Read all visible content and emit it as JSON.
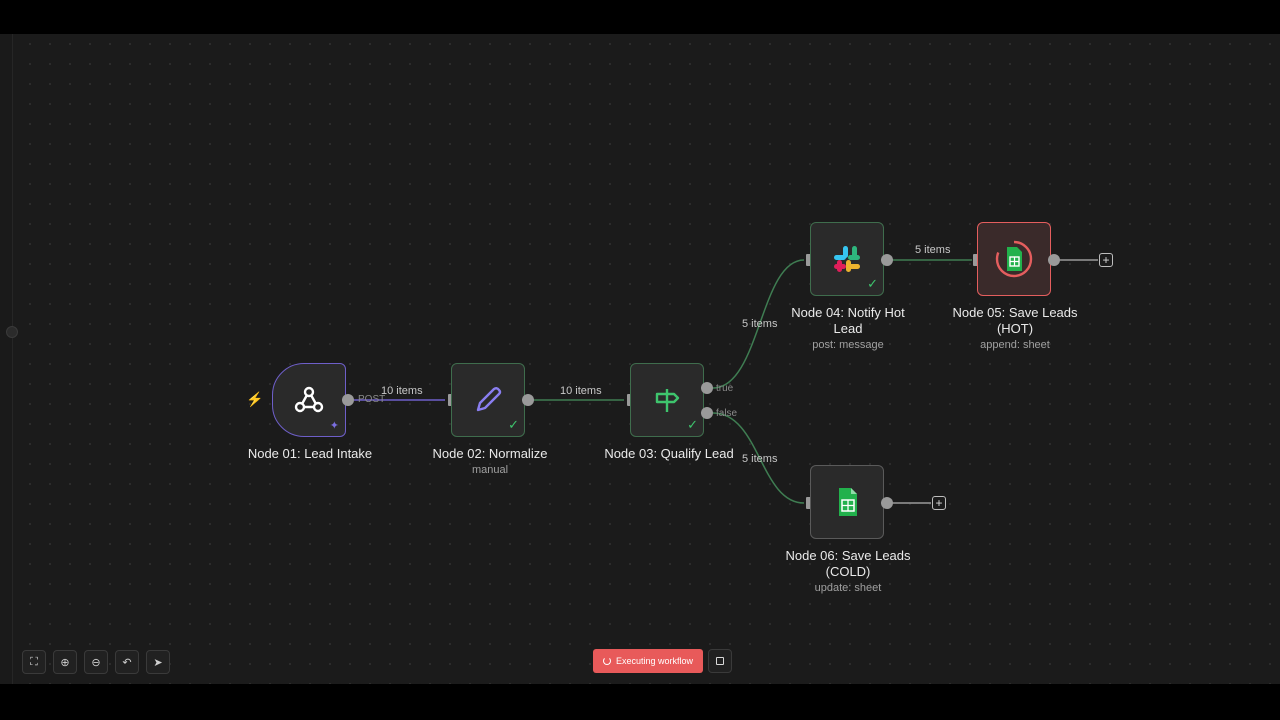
{
  "nodes": {
    "n01": {
      "title": "Node 01: Lead Intake",
      "port_label": "POST"
    },
    "n02": {
      "title": "Node 02: Normalize",
      "subtitle": "manual"
    },
    "n03": {
      "title": "Node 03: Qualify Lead",
      "port_true": "true",
      "port_false": "false"
    },
    "n04": {
      "title_line1": "Node 04: Notify Hot",
      "title_line2": "Lead",
      "subtitle": "post: message"
    },
    "n05": {
      "title_line1": "Node 05: Save Leads",
      "title_line2": "(HOT)",
      "subtitle": "append: sheet"
    },
    "n06": {
      "title_line1": "Node 06: Save Leads",
      "title_line2": "(COLD)",
      "subtitle": "update: sheet"
    }
  },
  "edges": {
    "e1": "10 items",
    "e2": "10 items",
    "e3": "5 items",
    "e4": "5 items",
    "e5": "5 items"
  },
  "toolbar": {
    "execute_label": "Executing workflow",
    "icons": [
      "fit-view-icon",
      "zoom-in-icon",
      "zoom-out-icon",
      "undo-icon",
      "cursor-icon"
    ]
  },
  "colors": {
    "success": "#3ec46d",
    "error": "#e45e5e",
    "trigger": "#6e5fc9",
    "execute": "#e85a5a"
  }
}
